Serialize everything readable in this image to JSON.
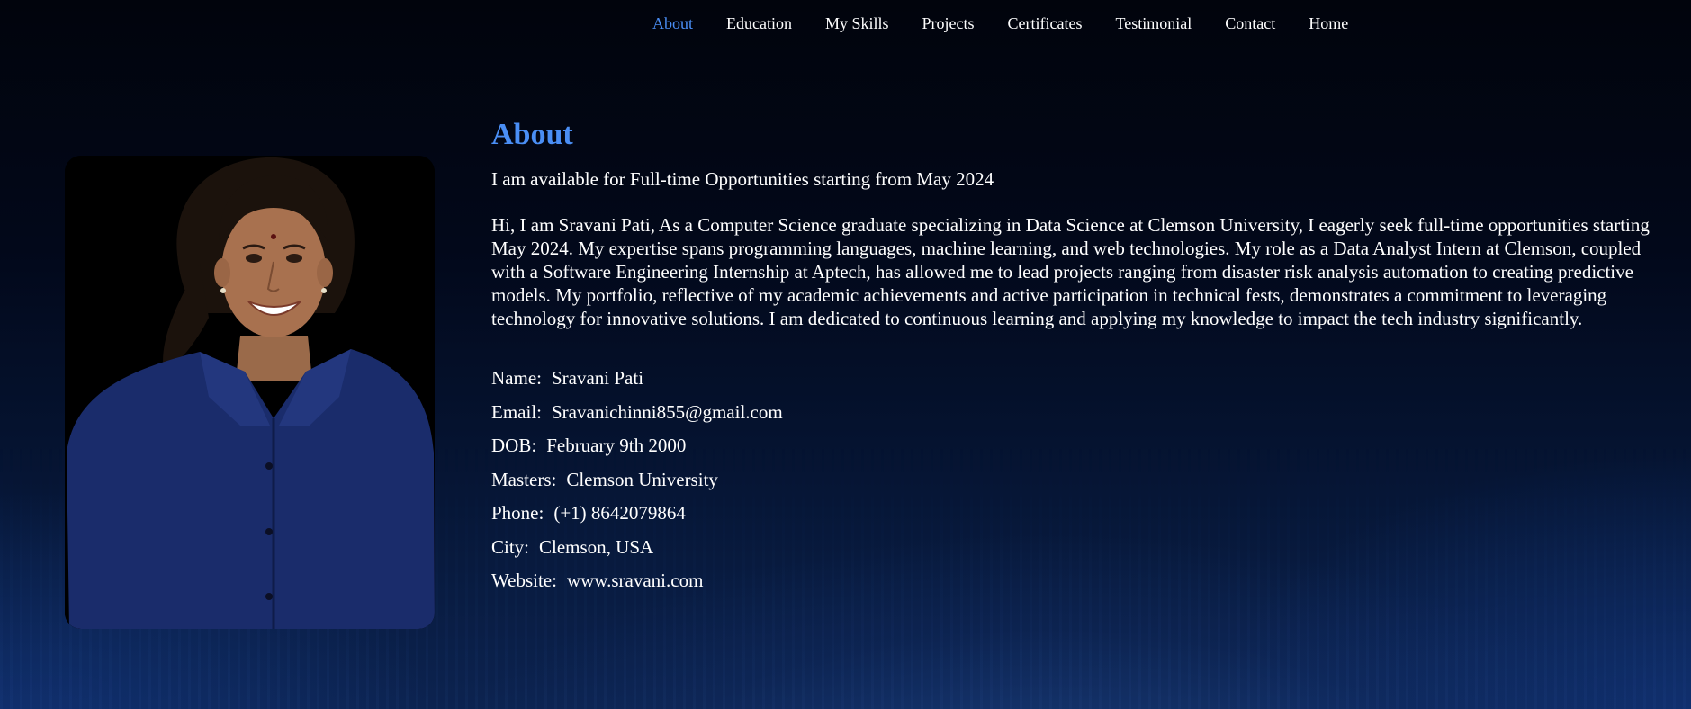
{
  "nav": {
    "items": [
      {
        "label": "About",
        "active": true
      },
      {
        "label": "Education"
      },
      {
        "label": "My Skills"
      },
      {
        "label": "Projects"
      },
      {
        "label": "Certificates"
      },
      {
        "label": "Testimonial"
      },
      {
        "label": "Contact"
      },
      {
        "label": "Home"
      }
    ]
  },
  "about": {
    "heading": "About",
    "availability": "I am available for Full-time Opportunities starting from May 2024",
    "bio": "Hi, I am Sravani Pati, As a Computer Science graduate specializing in Data Science at Clemson University, I eagerly seek full-time opportunities starting May 2024. My expertise spans programming languages, machine learning, and web technologies. My role as a Data Analyst Intern at Clemson, coupled with a Software Engineering Internship at Aptech, has allowed me to lead projects ranging from disaster risk analysis automation to creating predictive models. My portfolio, reflective of my academic achievements and active participation in technical fests, demonstrates a commitment to leveraging technology for innovative solutions. I am dedicated to continuous learning and applying my knowledge to impact the tech industry significantly.",
    "details": [
      {
        "label": "Name:",
        "value": "Sravani Pati"
      },
      {
        "label": "Email:",
        "value": "Sravanichinni855@gmail.com"
      },
      {
        "label": "DOB:",
        "value": "February 9th 2000"
      },
      {
        "label": "Masters:",
        "value": "Clemson University"
      },
      {
        "label": "Phone:",
        "value": "(+1) 8642079864"
      },
      {
        "label": "City:",
        "value": "Clemson, USA"
      },
      {
        "label": "Website:",
        "value": "www.sravani.com"
      }
    ]
  },
  "colors": {
    "accent": "#4a8ef5",
    "text": "#ffffff",
    "shirt": "#1a2c6b"
  }
}
